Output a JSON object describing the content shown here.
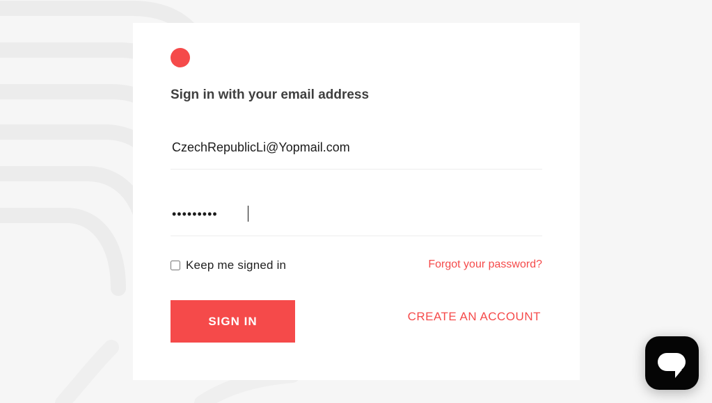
{
  "form": {
    "heading": "Sign in with your email address",
    "email_value": "CzechRepublicLi@Yopmail.com",
    "password_value": "•••••••••",
    "keep_signed_in_label": "Keep me signed in",
    "forgot_password_label": "Forgot your password?",
    "sign_in_label": "SIGN IN",
    "create_account_label": "CREATE AN ACCOUNT"
  },
  "icons": {
    "logo": "red-dot-logo",
    "chat": "chat-bubble-icon"
  },
  "colors": {
    "accent": "#f54a4a",
    "background": "#f6f6f6",
    "card": "#ffffff",
    "heading_text": "#3f3f3f",
    "chat_button": "#050505"
  }
}
